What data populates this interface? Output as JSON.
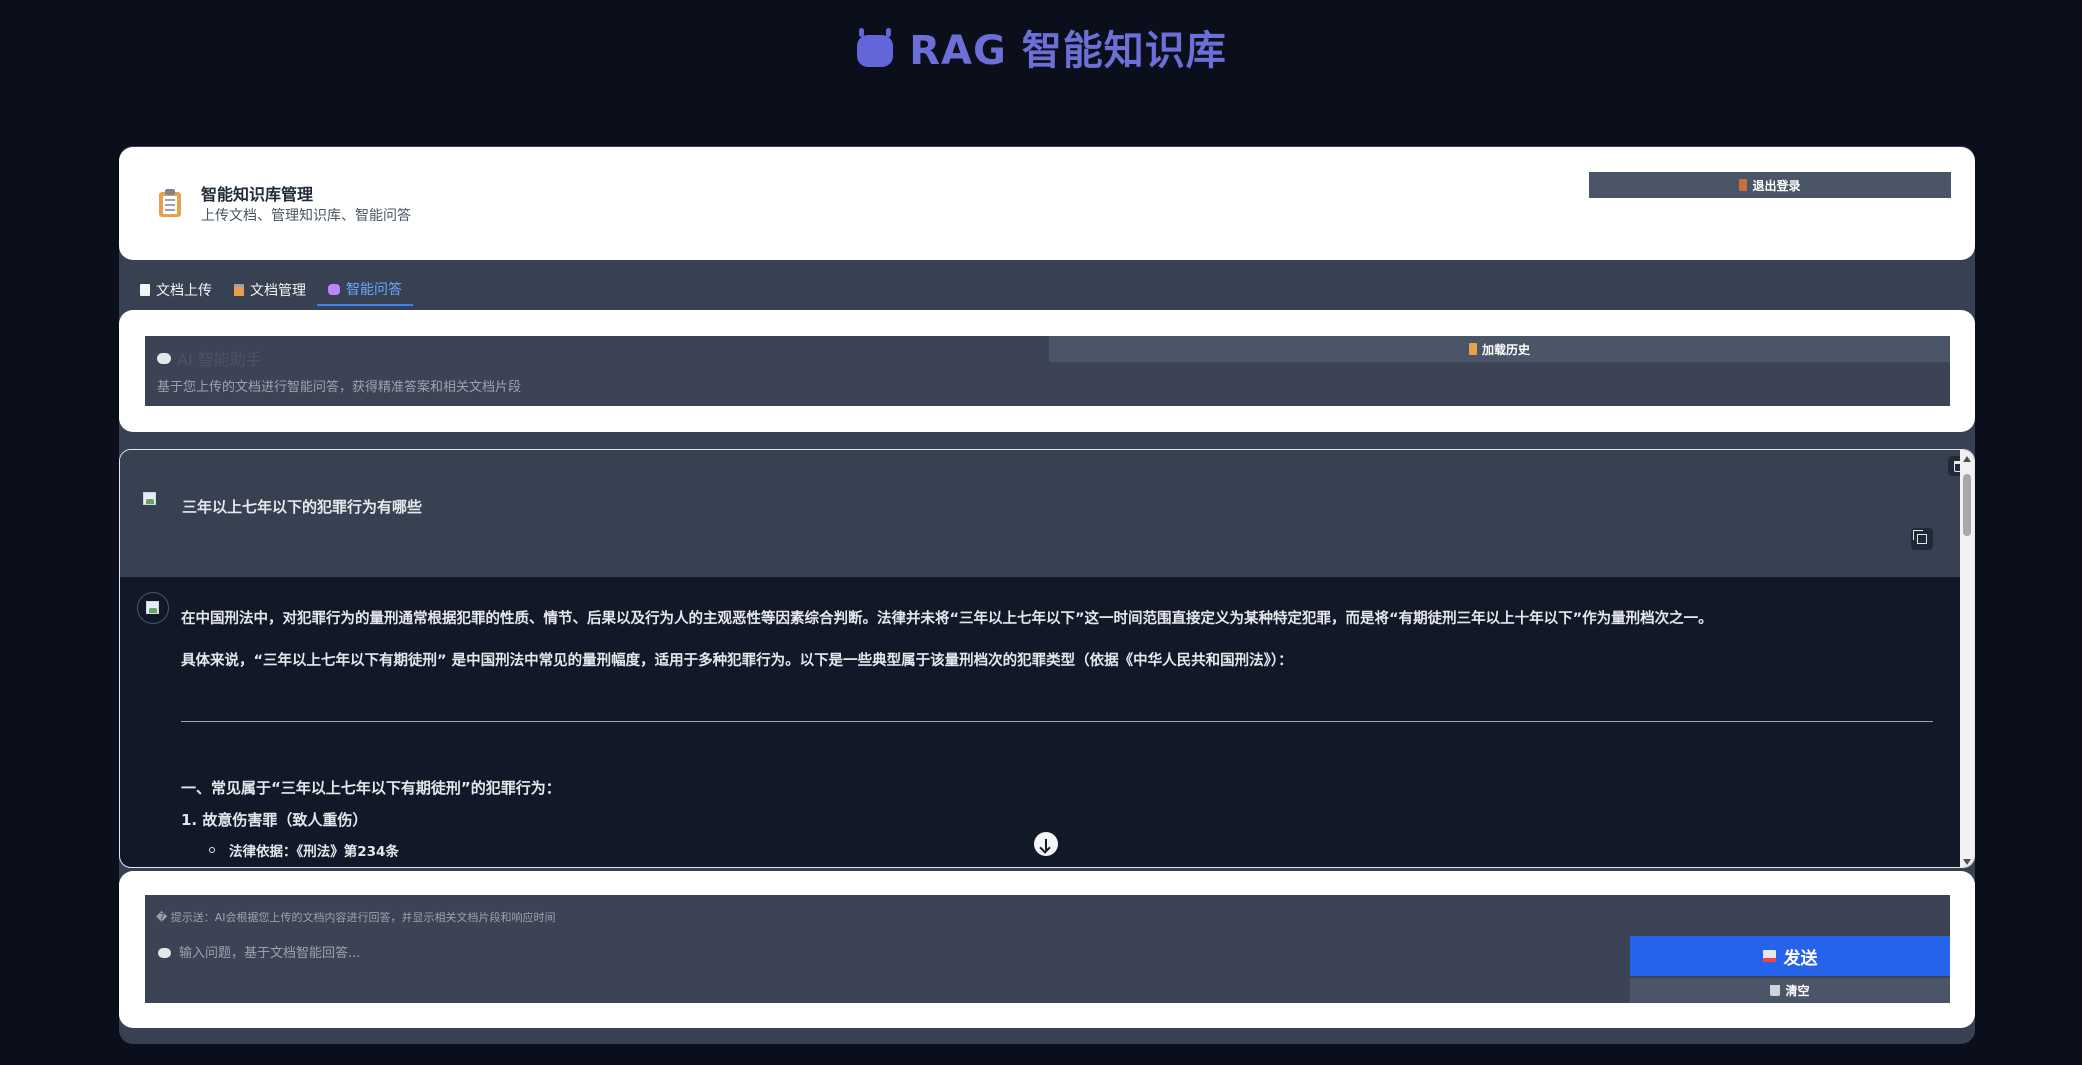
{
  "app": {
    "title": "RAG 智能知识库",
    "icon": "robot-icon"
  },
  "header": {
    "title": "智能知识库管理",
    "subtitle": "上传文档、管理知识库、智能问答",
    "logout_label": "退出登录"
  },
  "tabs": [
    {
      "label": "文档上传",
      "icon": "document-icon"
    },
    {
      "label": "文档管理",
      "icon": "clipboard-icon"
    },
    {
      "label": "智能问答",
      "icon": "robot-icon",
      "active": true
    }
  ],
  "assistant": {
    "title": "AI 智能助手",
    "subtitle": "基于您上传的文档进行智能问答，获得精准答案和相关文档片段",
    "history_label": "加载历史"
  },
  "chat": {
    "user_message": "三年以上七年以下的犯罪行为有哪些",
    "ai_paragraph_1": "在中国刑法中，对犯罪行为的量刑通常根据犯罪的性质、情节、后果以及行为人的主观恶性等因素综合判断。法律并未将“三年以上七年以下”这一时间范围直接定义为某种特定犯罪，而是将“有期徒刑三年以上十年以下”作为量刑档次之一。",
    "ai_paragraph_2_prefix": "具体来说，",
    "ai_paragraph_2_bold": "“三年以上七年以下有期徒刑”",
    "ai_paragraph_2_suffix": " 是中国刑法中常见的量刑幅度，适用于多种犯罪行为。以下是一些典型属于该量刑档次的犯罪类型（依据《中华人民共和国刑法》）：",
    "ai_heading": "一、常见属于“三年以上七年以下有期徒刑”的犯罪行为：",
    "ai_list_item_1": "1. 故意伤害罪（致人重伤）",
    "ai_sub_item_1": "法律依据：《刑法》第234条"
  },
  "input": {
    "hint": "� 提示送：AI会根据您上传的文档内容进行回答，并显示相关文档片段和响应时间",
    "placeholder": "输入问题，基于文档智能回答...",
    "send_label": "发送",
    "clear_label": "清空"
  },
  "colors": {
    "page_bg": "#0b0f1c",
    "brand": "#6b6fd6",
    "accent": "#3b82f6",
    "send": "#2563eb",
    "panel": "#384152"
  }
}
